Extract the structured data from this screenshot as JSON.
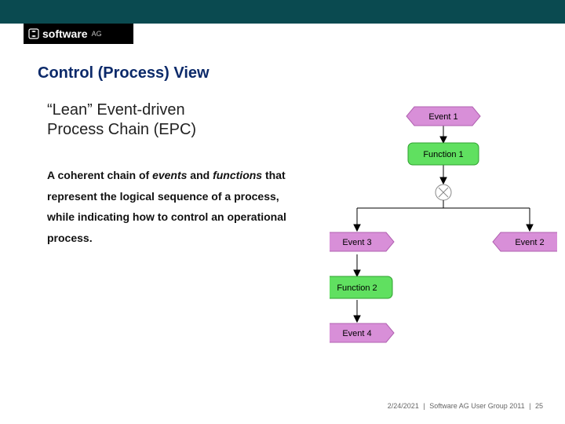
{
  "brand": {
    "logo_text": "software",
    "logo_suffix": "AG"
  },
  "title": "Control (Process) View",
  "subtitle_line1": "“Lean” Event-driven",
  "subtitle_line2": "Process Chain (EPC)",
  "body": {
    "pre1": "A coherent chain of ",
    "em1": "events",
    "mid1": " and ",
    "em2": "functions",
    "rest": " that represent the logical sequence of a process, while indicating how to control an operational process."
  },
  "diagram": {
    "event1": "Event 1",
    "function1": "Function 1",
    "event2": "Event 2",
    "event3": "Event 3",
    "function2": "Function 2",
    "event4": "Event 4",
    "colors": {
      "event_fill": "#d88fd8",
      "event_stroke": "#b060b0",
      "function_fill": "#60e060",
      "function_stroke": "#30a030",
      "line": "#000000"
    }
  },
  "footer": {
    "date": "2/24/2021",
    "sep": "|",
    "org": "Software AG User Group 2011",
    "page": "25"
  }
}
